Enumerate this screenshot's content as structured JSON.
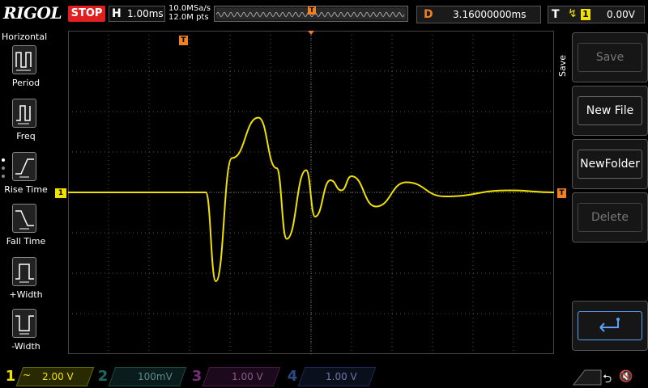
{
  "brand": "RIGOL",
  "run_state": "STOP",
  "colors": {
    "ch1": "#f0e000",
    "ch2": "#1a8a8a",
    "ch3": "#c030c0",
    "ch4": "#2060c0",
    "trigger": "#f08020",
    "stop": "#e02020",
    "grid": "#555555"
  },
  "horizontal": {
    "label": "H",
    "timebase": "1.00ms",
    "sample_rate": "10.0MSa/s",
    "mem_depth": "12.0M pts"
  },
  "delay": {
    "label": "D",
    "value": "3.16000000ms"
  },
  "trigger": {
    "label": "T",
    "edge_icon": "rising-edge-icon",
    "source": "1",
    "level": "0.00V",
    "marker": "T"
  },
  "left_menu": {
    "title": "Horizontal",
    "items": [
      {
        "label": "Period",
        "icon": "period-icon"
      },
      {
        "label": "Freq",
        "icon": "freq-icon"
      },
      {
        "label": "Rise Time",
        "icon": "rise-time-icon"
      },
      {
        "label": "Fall Time",
        "icon": "fall-time-icon"
      },
      {
        "label": "+Width",
        "icon": "pos-width-icon"
      },
      {
        "label": "-Width",
        "icon": "neg-width-icon"
      }
    ]
  },
  "right_menu": {
    "title": "Save",
    "items": [
      {
        "label": "Save",
        "enabled": false
      },
      {
        "label": "New File",
        "enabled": true
      },
      {
        "label": "NewFolder",
        "enabled": true
      },
      {
        "label": "Delete",
        "enabled": false
      },
      {
        "label": "",
        "icon": "return-icon",
        "enabled": true
      }
    ]
  },
  "channel1_marker": "1",
  "channels": [
    {
      "num": "1",
      "coupling": "~",
      "scale": "2.00 V"
    },
    {
      "num": "2",
      "coupling": "",
      "scale": "100mV"
    },
    {
      "num": "3",
      "coupling": "",
      "scale": "1.00 V"
    },
    {
      "num": "4",
      "coupling": "",
      "scale": "1.00 V"
    }
  ],
  "status_icons": [
    "usb-icon",
    "speaker-muted-icon"
  ],
  "waveform": {
    "type": "damped-oscillation",
    "baseline_div": 0.0,
    "trigger_time_div": -4.0,
    "peaks": [
      {
        "t_div": -2.35,
        "v_div": -2.2
      },
      {
        "t_div": -1.95,
        "v_div": 0.85
      },
      {
        "t_div": -1.3,
        "v_div": 1.85
      },
      {
        "t_div": -0.85,
        "v_div": 0.6
      },
      {
        "t_div": -0.6,
        "v_div": -1.15
      },
      {
        "t_div": -0.12,
        "v_div": 0.55
      },
      {
        "t_div": 0.1,
        "v_div": -0.6
      },
      {
        "t_div": 0.48,
        "v_div": 0.3
      },
      {
        "t_div": 0.75,
        "v_div": 0.05
      },
      {
        "t_div": 1.0,
        "v_div": 0.4
      },
      {
        "t_div": 1.6,
        "v_div": -0.35
      },
      {
        "t_div": 2.35,
        "v_div": 0.25
      },
      {
        "t_div": 3.3,
        "v_div": -0.1
      },
      {
        "t_div": 4.9,
        "v_div": 0.05
      }
    ]
  }
}
